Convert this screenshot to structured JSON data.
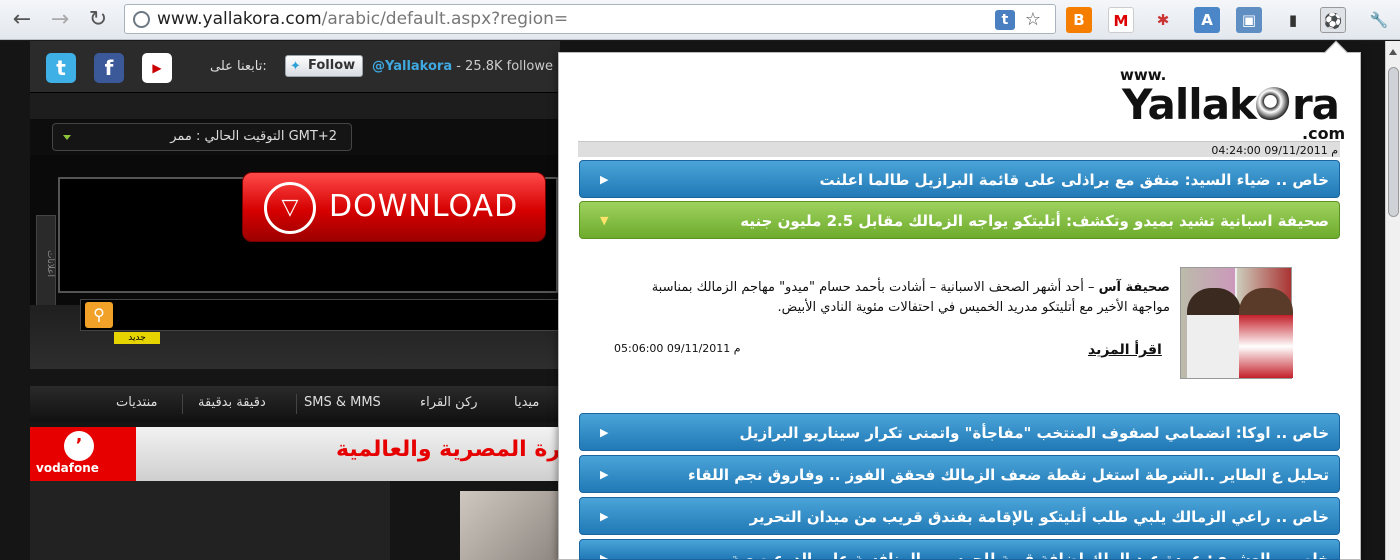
{
  "browser": {
    "url_host": "www.yallakora.com",
    "url_path": "/arabic/default.aspx?region=",
    "back_icon": "arrow-left",
    "forward_icon": "arrow-right",
    "reload_icon": "reload",
    "extensions": [
      "blogger-icon",
      "gmail-icon",
      "star-ext-icon",
      "translate-icon",
      "screen-ext-icon",
      "phone-ext-icon",
      "football-ext-icon"
    ],
    "wrench_icon": "wrench"
  },
  "social": {
    "follow_label": "تابعنا على:",
    "follow_button": "Follow",
    "handle": "@Yallakora",
    "handle_suffix": " - 25.8K followe"
  },
  "clock": {
    "text": "التوقيت الحالي : ممر GMT+2"
  },
  "banner": {
    "ads_tab": "اعلانات",
    "download_label": "DOWNLOAD"
  },
  "search": {
    "new_badge": "جديد"
  },
  "menu": {
    "items": [
      "منتديات",
      "دقيقة بدقيقة",
      "SMS & MMS",
      "ركن القراء",
      "ميديا"
    ]
  },
  "ad": {
    "brand": "vodafone",
    "text": "رة المصرية والعالمية"
  },
  "popup": {
    "logo_www": "www.",
    "logo_main": "Yallak",
    "logo_rest": "ra",
    "logo_com": ".com",
    "date": "04:24:00 09/11/2011 م",
    "news": [
      {
        "title": "خاص .. ضياء السيد: منفق مع براذلى على قائمة البرازيل طالما اعلنت",
        "color": "blue"
      },
      {
        "title": "صحيفة اسبانية تشيد بميدو وتكشف: أتليتكو يواجه الزمالك مقابل 2.5 مليون جنيه",
        "color": "green"
      }
    ],
    "story": {
      "text_bold": "صحيفة آس",
      "text": " – أحد أشهر الصحف الاسبانية – أشادت بأحمد حسام \"ميدو\" مهاجم الزمالك بمناسبة مواجهة الأخير مع أتليتكو مدريد الخميس في احتفالات مئوية النادي الأبيض.",
      "read_more": "اقرأ المزيد",
      "date": "05:06:00 09/11/2011 م"
    },
    "news_more": [
      "خاص .. اوكا: انضمامي لصفوف المنتخب \"مفاجأة\" واتمنى تكرار سيناريو البرازيل",
      "تحليل ع الطاير ..الشرطة استغل نقطة ضعف الزمالك فحقق الفوز .. وفاروق نجم اللقاء",
      "خاص .. راعي الزمالك يلبي طلب أتليتكو بالإقامة بفندق قريب من ميدان التحرير",
      "خاص .. العشري: عودة عبد الملك إضافة قوية للحرس .. المنافسة على الدرع صعبة"
    ]
  }
}
